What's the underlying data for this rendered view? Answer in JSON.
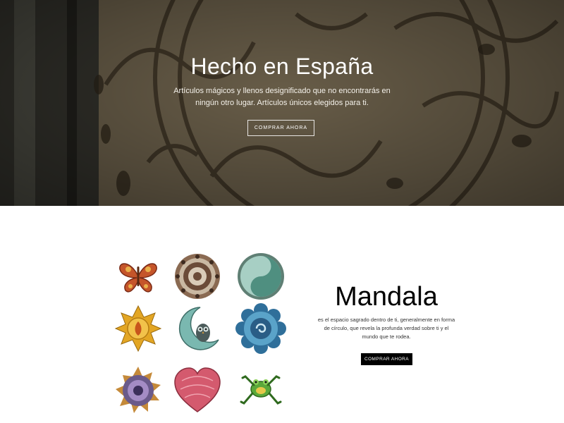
{
  "hero": {
    "title": "Hecho en España",
    "subtitle": "Artículos mágicos y llenos designificado que no encontrarás en ningún otro lugar. Artículos únicos elegidos para ti.",
    "button_label": "COMPRAR AHORA"
  },
  "product_grid": {
    "items": [
      {
        "icon": "butterfly-icon"
      },
      {
        "icon": "brown-mandala-icon"
      },
      {
        "icon": "teal-mandala-icon"
      },
      {
        "icon": "golden-sun-icon"
      },
      {
        "icon": "owl-moon-icon"
      },
      {
        "icon": "blue-mandala-icon"
      },
      {
        "icon": "purple-mandala-icon"
      },
      {
        "icon": "heart-icon"
      },
      {
        "icon": "frog-icon"
      }
    ]
  },
  "feature": {
    "title": "Mandala",
    "description": "es el espacio sagrado dentro de ti, generalmente en forma de círculo, que revela la profunda verdad sobre ti y el mundo que te rodea.",
    "button_label": "COMPRAR AHORA"
  },
  "colors": {
    "hero_overlay": "#2b2a23",
    "button_dark": "#000000",
    "text_light": "#ffffff"
  }
}
